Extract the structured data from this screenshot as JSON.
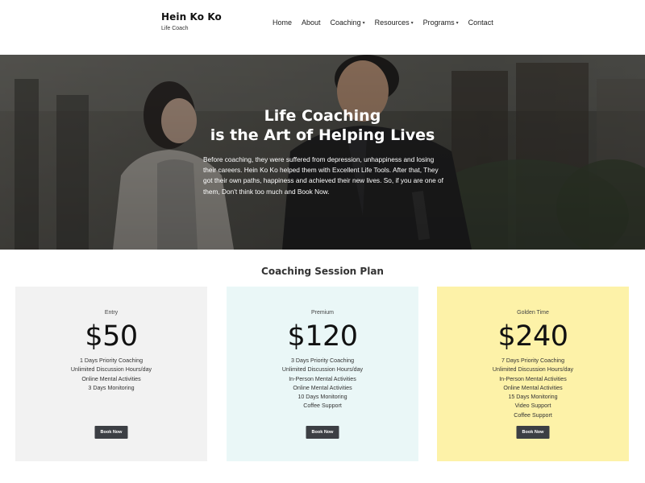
{
  "brand": {
    "name": "Hein Ko Ko",
    "tagline": "Life Coach"
  },
  "nav": {
    "items": [
      {
        "label": "Home",
        "dropdown": false
      },
      {
        "label": "About",
        "dropdown": false
      },
      {
        "label": "Coaching",
        "dropdown": true
      },
      {
        "label": "Resources",
        "dropdown": true
      },
      {
        "label": "Programs",
        "dropdown": true
      },
      {
        "label": "Contact",
        "dropdown": false
      }
    ]
  },
  "hero": {
    "title_line1": "Life Coaching",
    "title_line2": "is the Art of Helping Lives",
    "body": "Before coaching, they were suffered from depression, unhappiness and losing their careers. Hein Ko Ko helped them with Excellent Life Tools. After that, They got their own paths, happiness and achieved their new lives. So, if you are one of them, Don't think too much and Book Now."
  },
  "plans": {
    "title": "Coaching Session Plan",
    "cards": [
      {
        "tier": "Entry",
        "price": "$50",
        "color": "#f2f2f2",
        "features": [
          "1 Days Priority Coaching",
          "Unlimited Discussion Hours/day",
          "Online Mental Activities",
          "3 Days Monitoring"
        ],
        "button": "Book Now"
      },
      {
        "tier": "Premium",
        "price": "$120",
        "color": "#eaf7f7",
        "features": [
          "3 Days Priority Coaching",
          "Unlimited Discussion Hours/day",
          "In-Person Mental Activities",
          "Online Mental Activities",
          "10 Days Monitoring",
          "Coffee Support"
        ],
        "button": "Book Now"
      },
      {
        "tier": "Golden Time",
        "price": "$240",
        "color": "#fdf2a8",
        "features": [
          "7 Days Priority Coaching",
          "Unlimited Discussion Hours/day",
          "In-Person Mental Activities",
          "Online Mental Activities",
          "15 Days Monitoring",
          "Video Support",
          "Coffee Support"
        ],
        "button": "Book Now"
      }
    ]
  },
  "colors": {
    "button_bg": "#3c3f44",
    "hero_overlay": "#2f2f2c"
  }
}
